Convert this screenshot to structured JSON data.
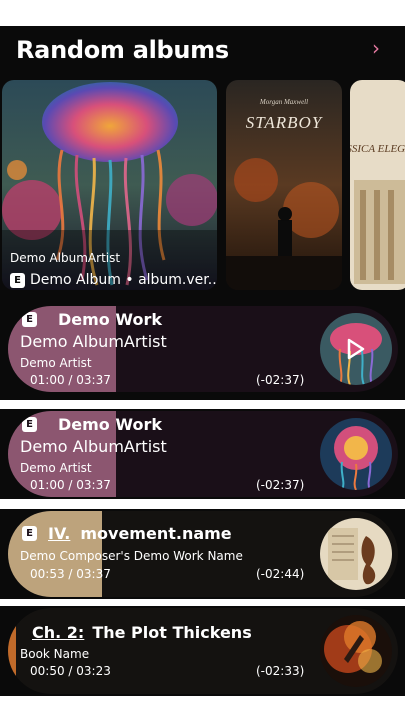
{
  "header": {
    "title": "Random albums",
    "more_icon": "chevron-right-icon"
  },
  "albums": [
    {
      "artist": "Demo AlbumArtist",
      "explicit_badge": "E",
      "title_line": "Demo Album • album.ver..."
    },
    {
      "cover_text_top": "Morgan Maxwell",
      "cover_text_main": "STARBOY"
    },
    {
      "cover_text_main": "LASSICA ELEGANC"
    }
  ],
  "now_playing": [
    {
      "badge": "E",
      "title": "Demo Work",
      "subtitle": "Demo AlbumArtist",
      "artist": "Demo Artist",
      "elapsed": "01:00 / 03:37",
      "remaining": "(-02:37)",
      "progress": 0.27,
      "accent": "#8c5670",
      "show_play": true
    },
    {
      "badge": "E",
      "title": "Demo Work",
      "subtitle": "Demo AlbumArtist",
      "artist": "Demo Artist",
      "elapsed": "01:00 / 03:37",
      "remaining": "(-02:37)",
      "progress": 0.27,
      "accent": "#8c5670",
      "show_play": false
    },
    {
      "badge": "E",
      "movement_number": "IV.",
      "title": "movement.name",
      "composer_line": "Demo Composer's Demo Work Name",
      "elapsed": "00:53 / 03:37",
      "remaining": "(-02:44)",
      "progress": 0.24,
      "accent": "#bda37c"
    },
    {
      "chapter": "Ch. 2:",
      "title": "The Plot Thickens",
      "book": "Book Name",
      "elapsed": "00:50 / 03:23",
      "remaining": "(-02:33)",
      "progress": 0.02,
      "accent": "#c06a2a"
    }
  ]
}
